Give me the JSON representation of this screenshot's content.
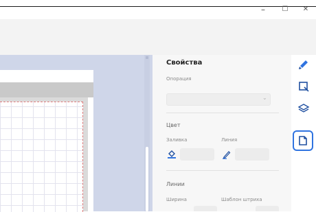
{
  "window": {
    "minimize": "–",
    "maximize": "☐",
    "close": "✕"
  },
  "properties": {
    "title": "Свойства",
    "opacity_label": "Опорация",
    "opacity_value": "",
    "color_section": "Цвет",
    "fill_label": "Заливка",
    "line_label": "Линия",
    "lines_section": "Линии",
    "width_label": "Ширина",
    "stroke_pattern_label": "Шаблон штриха"
  },
  "rail": {
    "items": [
      "paint-brush-icon",
      "selection-icon",
      "layers-icon",
      "document-icon"
    ],
    "active": "document-icon"
  },
  "colors": {
    "accent": "#2f73e0",
    "canvas_bg": "#cfd6e9"
  }
}
